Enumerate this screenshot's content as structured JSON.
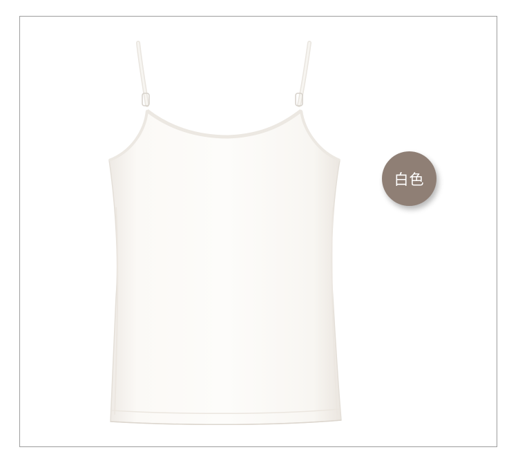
{
  "product": {
    "color_label": "白色",
    "badge_color": "#8f7f75",
    "garment_color": "#fbf9f6"
  }
}
